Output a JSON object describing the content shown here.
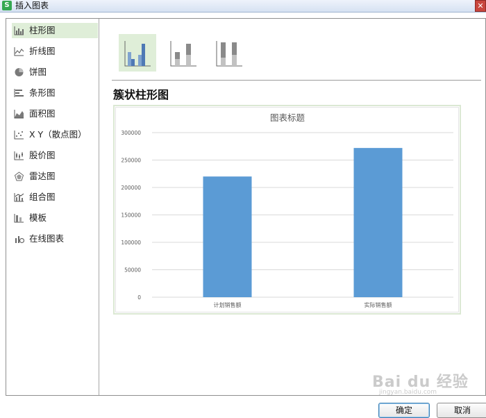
{
  "window": {
    "title": "插入图表",
    "app_icon_letter": "S",
    "close_glyph": "✕"
  },
  "sidebar": {
    "items": [
      {
        "label": "柱形图",
        "icon": "column-chart-icon",
        "selected": true
      },
      {
        "label": "折线图",
        "icon": "line-chart-icon"
      },
      {
        "label": "饼图",
        "icon": "pie-chart-icon"
      },
      {
        "label": "条形图",
        "icon": "bar-chart-icon"
      },
      {
        "label": "面积图",
        "icon": "area-chart-icon"
      },
      {
        "label": "X Y（散点图）",
        "icon": "scatter-chart-icon"
      },
      {
        "label": "股价图",
        "icon": "stock-chart-icon"
      },
      {
        "label": "雷达图",
        "icon": "radar-chart-icon"
      },
      {
        "label": "组合图",
        "icon": "combo-chart-icon"
      },
      {
        "label": "模板",
        "icon": "template-icon"
      },
      {
        "label": "在线图表",
        "icon": "online-chart-icon"
      }
    ]
  },
  "subtypes": [
    {
      "name": "clustered-column",
      "selected": true
    },
    {
      "name": "stacked-column"
    },
    {
      "name": "percent-stacked-column"
    }
  ],
  "chart_type_heading": "簇状柱形图",
  "chart_data": {
    "type": "bar",
    "title": "图表标题",
    "categories": [
      "计划销售额",
      "实际销售额"
    ],
    "values": [
      220000,
      272000
    ],
    "ylim": [
      0,
      300000
    ],
    "yticks": [
      0,
      50000,
      100000,
      150000,
      200000,
      250000,
      300000
    ],
    "ytick_labels": [
      "0",
      "50000",
      "100000",
      "150000",
      "200000",
      "250000",
      "300000"
    ],
    "xlabel": "",
    "ylabel": "",
    "grid": true,
    "bar_color": "#5b9bd5"
  },
  "buttons": {
    "ok": "确定",
    "cancel": "取消"
  },
  "watermark": {
    "text": "Bai du 经验",
    "sub": "jingyan.baidu.com"
  },
  "colors": {
    "selection": "#dfeed8",
    "bar": "#5b9bd5",
    "gray_bar": "#a6a6a6"
  }
}
